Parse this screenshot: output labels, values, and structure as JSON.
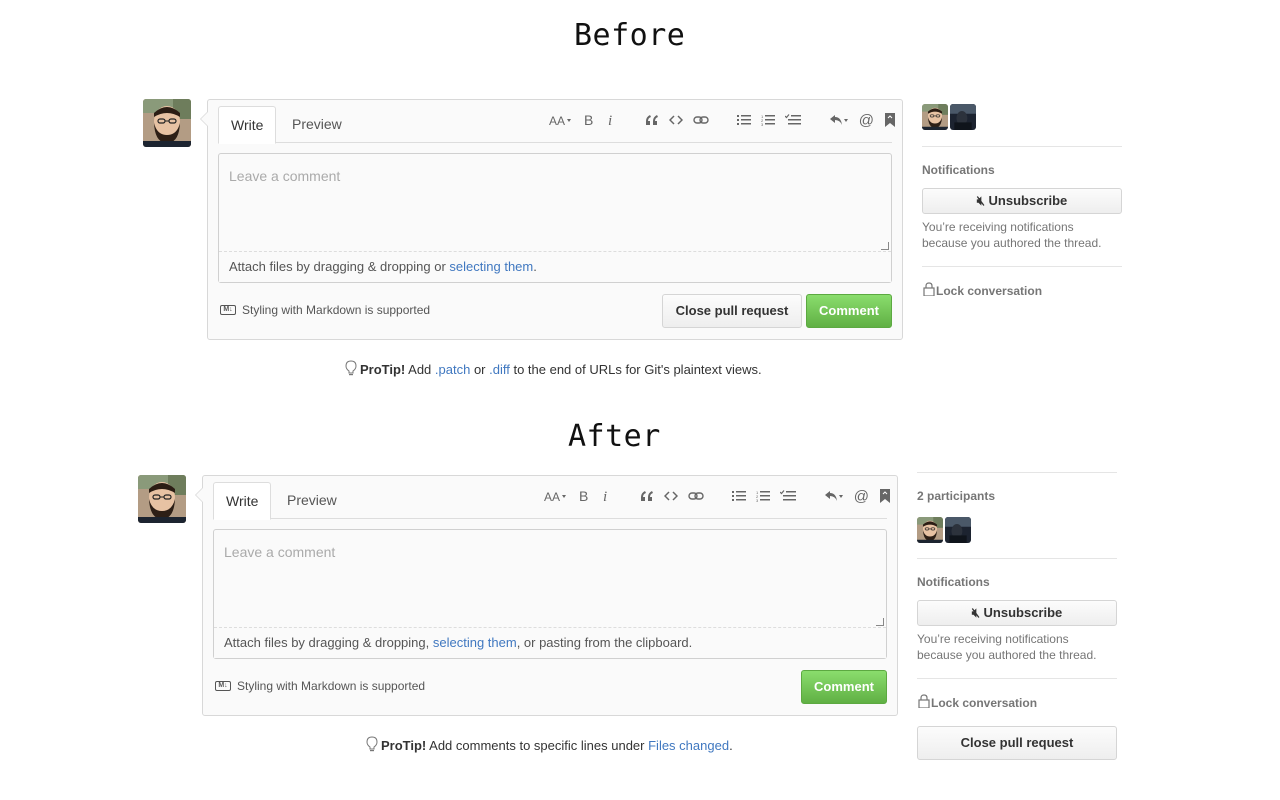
{
  "before": {
    "heading": "Before",
    "tabs": {
      "write": "Write",
      "preview": "Preview"
    },
    "placeholder": "Leave a comment",
    "attach": {
      "prefix": "Attach files by dragging & dropping or ",
      "link": "selecting them",
      "suffix": "."
    },
    "markdown_note": "Styling with Markdown is supported",
    "buttons": {
      "close": "Close pull request",
      "comment": "Comment"
    },
    "protip": {
      "label": "ProTip!",
      "t1": " Add ",
      "link1": ".patch",
      "t2": " or ",
      "link2": ".diff",
      "t3": " to the end of URLs for Git's plaintext views."
    },
    "sidebar": {
      "notifications_title": "Notifications",
      "unsubscribe": "Unsubscribe",
      "notify_text": "You’re receiving notifications because you authored the thread.",
      "lock": "Lock conversation"
    }
  },
  "after": {
    "heading": "After",
    "tabs": {
      "write": "Write",
      "preview": "Preview"
    },
    "placeholder": "Leave a comment",
    "attach": {
      "prefix": "Attach files by dragging & dropping, ",
      "link": "selecting them",
      "suffix": ", or pasting from the clipboard."
    },
    "markdown_note": "Styling with Markdown is supported",
    "buttons": {
      "comment": "Comment"
    },
    "protip": {
      "label": "ProTip!",
      "t1": " Add comments to specific lines under ",
      "link1": "Files changed",
      "t2": "."
    },
    "sidebar": {
      "participants_title": "2 participants",
      "notifications_title": "Notifications",
      "unsubscribe": "Unsubscribe",
      "notify_text": "You’re receiving notifications because you authored the thread.",
      "lock": "Lock conversation",
      "close": "Close pull request"
    }
  },
  "toolbar_icons": [
    "text-size-icon",
    "bold-icon",
    "italic-icon",
    "quote-icon",
    "code-icon",
    "link-icon",
    "bullet-list-icon",
    "numbered-list-icon",
    "task-list-icon",
    "reply-icon",
    "mention-icon",
    "bookmark-icon"
  ],
  "colors": {
    "link": "#4078c0",
    "primary_green": "#60b044",
    "muted": "#767676"
  }
}
